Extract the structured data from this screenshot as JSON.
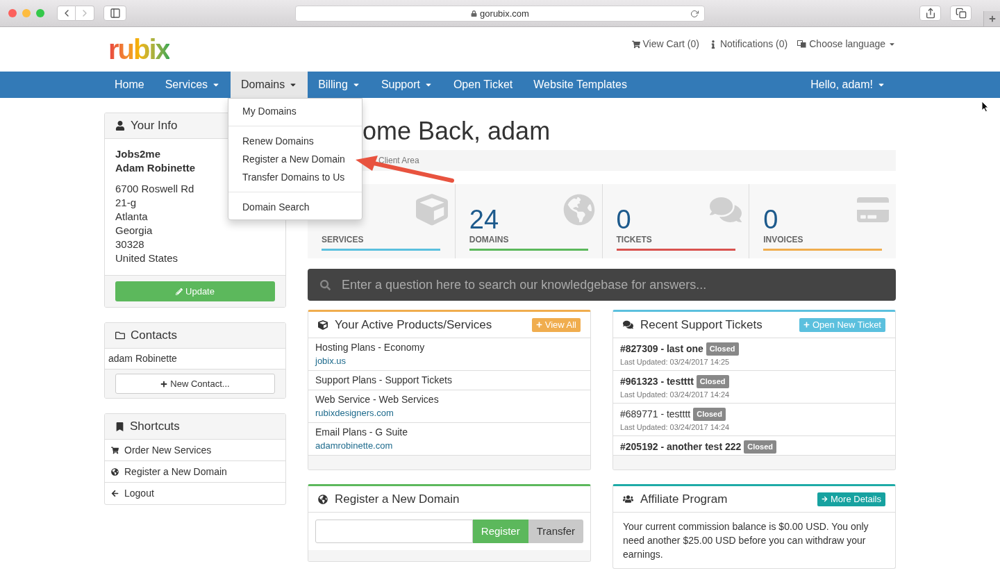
{
  "browser": {
    "url": "gorubix.com"
  },
  "header": {
    "logo": "rubix",
    "links": [
      {
        "kind": "cart",
        "label": "View Cart (0)"
      },
      {
        "kind": "info",
        "label": "Notifications (0)"
      },
      {
        "kind": "language",
        "label": "Choose language",
        "dropdown": true
      }
    ]
  },
  "nav": {
    "items": [
      {
        "label": "Home",
        "dropdown": false,
        "selected": false
      },
      {
        "label": "Services",
        "dropdown": true,
        "selected": false
      },
      {
        "label": "Domains",
        "dropdown": true,
        "selected": true
      },
      {
        "label": "Billing",
        "dropdown": true,
        "selected": false
      },
      {
        "label": "Support",
        "dropdown": true,
        "selected": false
      },
      {
        "label": "Open Ticket",
        "dropdown": false,
        "selected": false
      },
      {
        "label": "Website Templates",
        "dropdown": false,
        "selected": false
      }
    ],
    "user": "Hello, adam!"
  },
  "domains_menu": [
    [
      "My Domains"
    ],
    [
      "Renew Domains",
      "Register a New Domain",
      "Transfer Domains to Us"
    ],
    [
      "Domain Search"
    ]
  ],
  "your_info": {
    "title": "Your Info",
    "company": "Jobs2me",
    "name": "Adam Robinette",
    "address": [
      "6700 Roswell Rd",
      "21-g",
      "Atlanta",
      "Georgia",
      "30328",
      "United States"
    ],
    "button": "Update"
  },
  "contacts": {
    "title": "Contacts",
    "items": [
      "adam Robinette"
    ],
    "button": "New Contact..."
  },
  "shortcuts": {
    "title": "Shortcuts",
    "items": [
      {
        "kind": "cart",
        "label": "Order New Services"
      },
      {
        "kind": "globe",
        "label": "Register a New Domain"
      },
      {
        "kind": "back",
        "label": "Logout"
      }
    ]
  },
  "heading": "ome Back, adam",
  "breadcrumb": "Client Area",
  "stats": [
    {
      "kind": "services",
      "label": "SERVICES",
      "color": "#5bc0de"
    },
    {
      "kind": "domains",
      "value": "24",
      "label": "DOMAINS",
      "color": "#5cb85c"
    },
    {
      "kind": "tickets",
      "value": "0",
      "label": "TICKETS",
      "color": "#d9534f"
    },
    {
      "kind": "invoices",
      "value": "0",
      "label": "INVOICES",
      "color": "#f0ad4e"
    }
  ],
  "kb_search": {
    "placeholder": "Enter a question here to search our knowledgebase for answers..."
  },
  "products": {
    "title": "Your Active Products/Services",
    "button": "View All",
    "items": [
      {
        "name": "Hosting Plans - Economy",
        "domain": "jobix.us"
      },
      {
        "name": "Support Plans - Support Tickets"
      },
      {
        "name": "Web Service - Web Services",
        "domain": "rubixdesigners.com"
      },
      {
        "name": "Email Plans - G Suite",
        "domain": "adamrobinette.com"
      }
    ]
  },
  "tickets": {
    "title": "Recent Support Tickets",
    "button": "Open New Ticket",
    "items": [
      {
        "subject": "#827309 - last one",
        "unread": true,
        "status": "Closed",
        "updated": "Last Updated: 03/24/2017 14:25"
      },
      {
        "subject": "#961323 - testttt",
        "unread": true,
        "status": "Closed",
        "updated": "Last Updated: 03/24/2017 14:24"
      },
      {
        "subject": "#689771 - testttt",
        "unread": false,
        "status": "Closed",
        "updated": "Last Updated: 03/24/2017 14:24"
      },
      {
        "subject": "#205192 - another test 222",
        "unread": true,
        "status": "Closed"
      }
    ]
  },
  "register_domain": {
    "title": "Register a New Domain",
    "register": "Register",
    "transfer": "Transfer"
  },
  "affiliate": {
    "title": "Affiliate Program",
    "button": "More Details",
    "text": "Your current commission balance is $0.00 USD. You only need another $25.00 USD before you can withdraw your earnings."
  }
}
